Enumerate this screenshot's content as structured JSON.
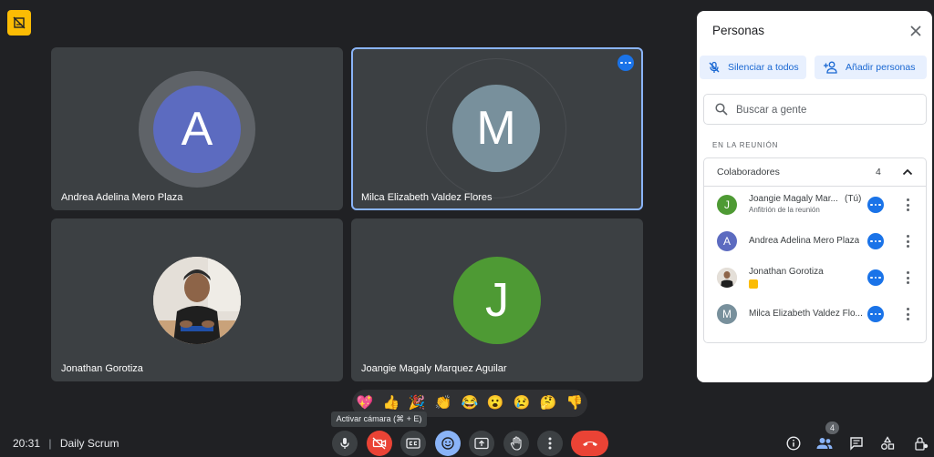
{
  "tiles": [
    {
      "name": "Andrea Adelina Mero Plaza",
      "initial": "A",
      "color": "#5c6bc0"
    },
    {
      "name": "Milca Elizabeth Valdez Flores",
      "initial": "M",
      "color": "#78909c"
    },
    {
      "name": "Jonathan Gorotiza"
    },
    {
      "name": "Joangie Magaly Marquez Aguilar",
      "initial": "J",
      "color": "#4e9a34"
    }
  ],
  "panel": {
    "title": "Personas",
    "mute_all_label": "Silenciar a todos",
    "add_people_label": "Añadir personas",
    "search_placeholder": "Buscar a gente",
    "section_label": "EN LA REUNIÓN",
    "group_label": "Colaboradores",
    "group_count": "4",
    "people": [
      {
        "name": "Joangie Magaly Mar...",
        "you": "(Tú)",
        "sub": "Anfitrión de la reunión",
        "initial": "J",
        "color": "#4e9a34"
      },
      {
        "name": "Andrea Adelina Mero Plaza",
        "initial": "A",
        "color": "#5c6bc0"
      },
      {
        "name": "Jonathan Gorotiza"
      },
      {
        "name": "Milca Elizabeth Valdez Flo...",
        "initial": "M",
        "color": "#78909c"
      }
    ]
  },
  "reactions": [
    "💖",
    "👍",
    "🎉",
    "👏",
    "😂",
    "😮",
    "😢",
    "🤔",
    "👎"
  ],
  "tooltip": "Activar cámara (⌘ + E)",
  "meeting": {
    "time": "20:31",
    "separator": "|",
    "name": "Daily Scrum"
  },
  "participants_badge": "4",
  "colors": {
    "accent": "#8ab4f8",
    "end_call": "#ea4335",
    "active_control": "#8ab4f8",
    "blue": "#1a73e8"
  }
}
